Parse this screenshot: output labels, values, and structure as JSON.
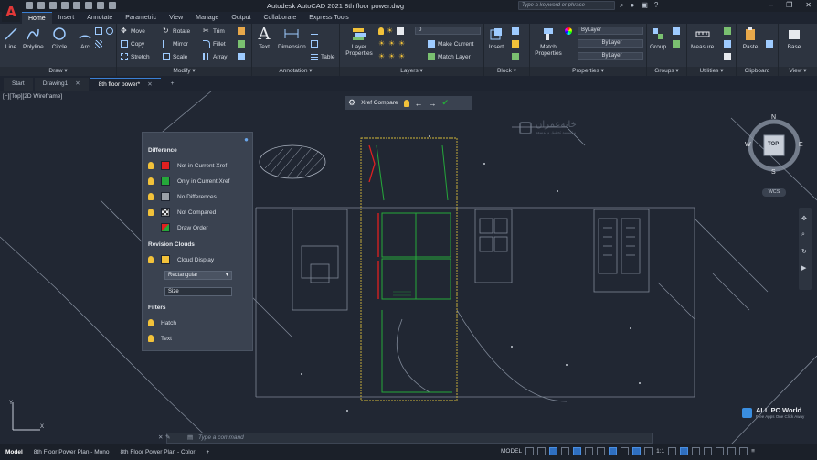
{
  "app": {
    "logo": "A",
    "title": "Autodesk AutoCAD 2021   8th floor power.dwg",
    "search_placeholder": "Type a keyword or phrase",
    "window_controls": [
      "–",
      "❐",
      "✕"
    ]
  },
  "ribbon_tabs": [
    "Home",
    "Insert",
    "Annotate",
    "Parametric",
    "View",
    "Manage",
    "Output",
    "Collaborate",
    "Express Tools"
  ],
  "ribbon": {
    "draw": {
      "title": "Draw ▾",
      "tools": [
        "Line",
        "Polyline",
        "Circle",
        "Arc"
      ]
    },
    "modify": {
      "title": "Modify ▾",
      "tools": [
        "Move",
        "Rotate",
        "Trim",
        "Copy",
        "Mirror",
        "Fillet",
        "Stretch",
        "Scale",
        "Array"
      ]
    },
    "annotation": {
      "title": "Annotation ▾",
      "tools": [
        "Text",
        "Dimension",
        "Table"
      ]
    },
    "layers": {
      "title": "Layers ▾",
      "layer_properties": "Layer Properties",
      "current_layer": "0",
      "make_current": "Make Current",
      "match_layer": "Match Layer"
    },
    "block": {
      "title": "Block ▾",
      "insert": "Insert"
    },
    "properties": {
      "title": "Properties ▾",
      "match_properties": "Match Properties",
      "bylayer_values": [
        "ByLayer",
        "ByLayer",
        "ByLayer"
      ]
    },
    "groups": {
      "title": "Groups ▾",
      "group": "Group"
    },
    "utilities": {
      "title": "Utilities ▾",
      "measure": "Measure"
    },
    "clipboard": {
      "title": "Clipboard",
      "paste": "Paste"
    },
    "view": {
      "title": "View ▾",
      "base": "Base"
    }
  },
  "doc_tabs": [
    {
      "label": "Start",
      "active": false
    },
    {
      "label": "Drawing1",
      "active": false
    },
    {
      "label": "8th floor power*",
      "active": true
    }
  ],
  "viewport": {
    "label": "[−][Top][2D Wireframe]",
    "xref_compare": "Xref Compare"
  },
  "compare_panel": {
    "difference_title": "Difference",
    "differences": [
      {
        "label": "Not in Current Xref",
        "color": "#e02020"
      },
      {
        "label": "Only in Current Xref",
        "color": "#25a83a"
      },
      {
        "label": "No Differences",
        "color": "#9aa0a8"
      },
      {
        "label": "Not Compared",
        "color": "checker"
      },
      {
        "label": "Draw Order",
        "color": "draw-order"
      }
    ],
    "revision_title": "Revision Clouds",
    "cloud_display": "Cloud Display",
    "cloud_shape": "Rectangular",
    "size_value": "Size",
    "filters_title": "Filters",
    "filters": [
      "Hatch",
      "Text"
    ]
  },
  "viewcube": {
    "top": "TOP",
    "n": "N",
    "s": "S",
    "e": "E",
    "w": "W",
    "wcs": "WCS"
  },
  "watermark": {
    "logo_text": "خانه‌عمران",
    "logo_sub": "مؤسسه تحقیق و توسعه",
    "allpc_title": "ALL PC World",
    "allpc_sub": "Free Apps One Click Away"
  },
  "command_line": {
    "placeholder": "Type a command"
  },
  "status_tabs": [
    {
      "label": "Model",
      "active": true
    },
    {
      "label": "8th Floor Power Plan - Mono",
      "active": false
    },
    {
      "label": "8th Floor Power Plan - Color",
      "active": false
    }
  ],
  "status": {
    "mode": "MODEL",
    "scale": "1:1"
  },
  "colors": {
    "accent": "#3a7fd4",
    "not_in_current": "#e02020",
    "only_in_current": "#25a83a",
    "xref_frame": "#d4b83a"
  }
}
